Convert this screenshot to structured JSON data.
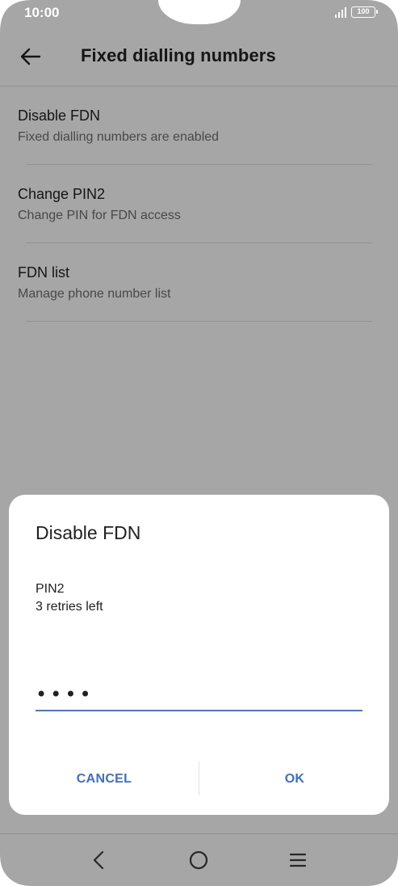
{
  "status_bar": {
    "time": "10:00",
    "battery_level": "100"
  },
  "app_bar": {
    "title": "Fixed dialling numbers",
    "back_icon": "arrow-left-icon"
  },
  "list": {
    "items": [
      {
        "title": "Disable FDN",
        "subtitle": "Fixed dialling numbers are enabled"
      },
      {
        "title": "Change PIN2",
        "subtitle": "Change PIN for FDN access"
      },
      {
        "title": "FDN list",
        "subtitle": "Manage phone number list"
      }
    ]
  },
  "dialog": {
    "title": "Disable FDN",
    "label": "PIN2",
    "retries": "3 retries left",
    "pin_value": "••••",
    "cancel_label": "CANCEL",
    "ok_label": "OK"
  },
  "nav_bar": {
    "back_icon": "nav-back-icon",
    "home_icon": "nav-home-icon",
    "recents_icon": "nav-menu-icon"
  },
  "colors": {
    "accent": "#3b6fc9",
    "underline": "#4a78c8",
    "scrim": "rgba(0,0,0,0.32)"
  }
}
